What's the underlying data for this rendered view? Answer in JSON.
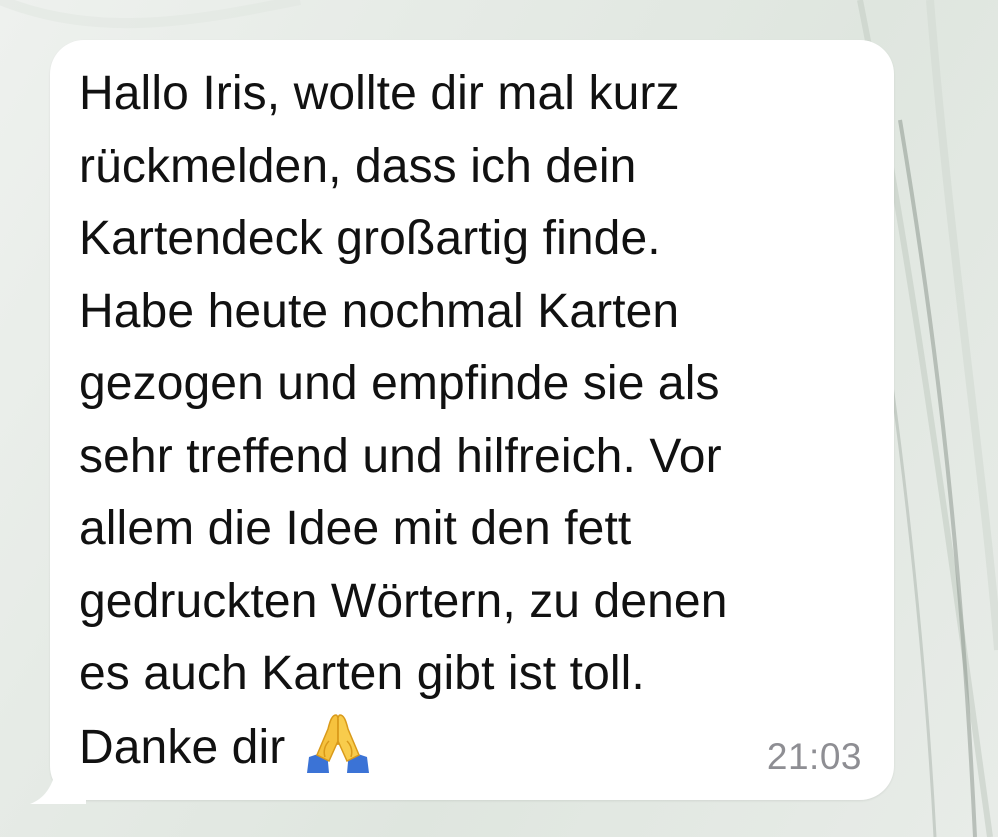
{
  "message": {
    "lines": [
      "Hallo Iris, wollte dir mal kurz",
      "rückmelden, dass ich dein",
      "Kartendeck großartig finde.",
      "Habe heute nochmal Karten",
      "gezogen und empfinde sie als",
      "sehr treffend und hilfreich. Vor",
      "allem die Idee mit den fett",
      "gedruckten Wörtern, zu denen",
      "es auch Karten gibt ist toll.",
      "Danke dir"
    ],
    "emoji": "folded-hands-icon",
    "timestamp": "21:03"
  },
  "colors": {
    "bubble": "#ffffff",
    "text": "#111111",
    "timestamp": "#8e8e93",
    "wallpaper": "#e6ebe6"
  }
}
